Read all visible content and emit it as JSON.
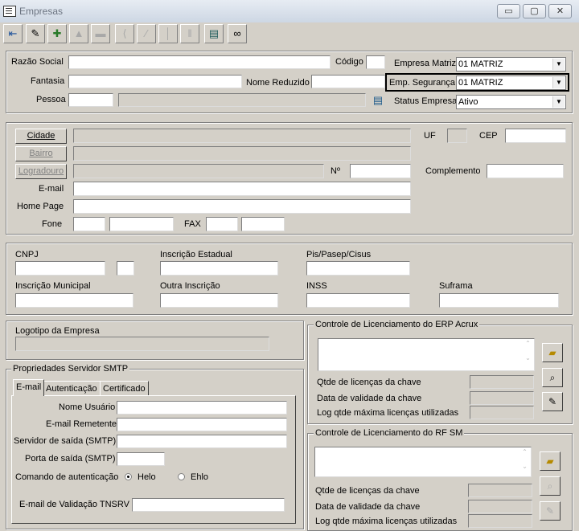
{
  "window": {
    "title": "Empresas",
    "min": "▭",
    "max": "▢",
    "close": "✕"
  },
  "toolbar": [
    {
      "name": "exit-icon",
      "glyph": "⇤",
      "disabled": false
    },
    {
      "name": "edit-icon",
      "glyph": "✎",
      "disabled": false
    },
    {
      "name": "add-icon",
      "glyph": "✚",
      "disabled": false
    },
    {
      "name": "save-icon",
      "glyph": "▲",
      "disabled": true
    },
    {
      "name": "delete-icon",
      "glyph": "▬",
      "disabled": true
    },
    {
      "name": "first-icon",
      "glyph": "⟨",
      "disabled": true
    },
    {
      "name": "prior-icon",
      "glyph": "∕",
      "disabled": true
    },
    {
      "name": "next-icon",
      "glyph": "│",
      "disabled": true
    },
    {
      "name": "last-icon",
      "glyph": "‖",
      "disabled": true
    },
    {
      "name": "list-icon",
      "glyph": "▤",
      "disabled": false
    },
    {
      "name": "binoculars-icon",
      "glyph": "👓",
      "disabled": false
    }
  ],
  "header": {
    "razao_social": "Razão Social",
    "codigo": "Código",
    "empresa_matriz": "Empresa Matriz",
    "empresa_matriz_value": "01 MATRIZ",
    "fantasia": "Fantasia",
    "nome_reduzido": "Nome Reduzido",
    "emp_seguranca": "Emp. Segurança",
    "emp_seguranca_value": "01 MATRIZ",
    "pessoa": "Pessoa",
    "status_empresa": "Status Empresa",
    "status_empresa_value": "Ativo"
  },
  "address": {
    "cidade": "Cidade",
    "bairro": "Bairro",
    "logradouro": "Logradouro",
    "uf": "UF",
    "cep": "CEP",
    "numero": "Nº",
    "complemento": "Complemento",
    "email": "E-mail",
    "home_page": "Home Page",
    "fone": "Fone",
    "fax": "FAX"
  },
  "docs": {
    "cnpj": "CNPJ",
    "inscricao_estadual": "Inscrição Estadual",
    "pis": "Pis/Pasep/Cisus",
    "inscricao_municipal": "Inscrição Municipal",
    "outra_inscricao": "Outra Inscrição",
    "inss": "INSS",
    "suframa": "Suframa"
  },
  "logo": {
    "label": "Logotipo da Empresa"
  },
  "smtp": {
    "legend": "Propriedades Servidor SMTP",
    "tabs": [
      "E-mail",
      "Autenticação",
      "Certificado"
    ],
    "nome_usuario": "Nome Usuário",
    "email_remetente": "E-mail Remetente",
    "servidor_saida": "Servidor de saída (SMTP)",
    "porta_saida": "Porta de saída (SMTP)",
    "comando_autenticacao": "Comando de autenticação",
    "helo": "Helo",
    "ehlo": "Ehlo",
    "email_validacao": "E-mail de Validação TNSRV"
  },
  "erp": {
    "legend": "Controle de Licenciamento do ERP Acrux",
    "qtde": "Qtde de licenças da chave",
    "validade": "Data de validade da chave",
    "log": "Log qtde máxima licenças utilizadas"
  },
  "rfsm": {
    "legend": "Controle de Licenciamento do RF SM",
    "qtde": "Qtde de licenças da chave",
    "validade": "Data de validade da chave",
    "log": "Log qtde máxima licenças utilizadas"
  }
}
